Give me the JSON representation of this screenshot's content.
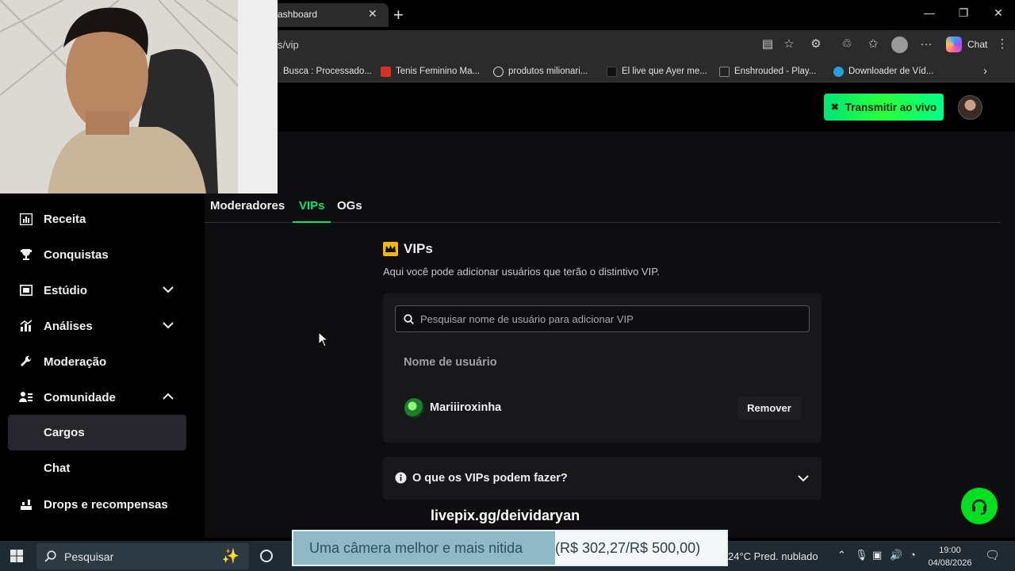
{
  "browser": {
    "tab_title": "ashboard",
    "url": "s/vip",
    "copilot_label": "Chat",
    "bookmarks": [
      {
        "label": "Busca : Processado...",
        "icon": "folder-icon"
      },
      {
        "label": "Tenis Feminino Ma...",
        "icon": "shop-icon"
      },
      {
        "label": "produtos milionari...",
        "icon": "globe-icon"
      },
      {
        "label": "El live que Ayer me...",
        "icon": "tiktok-icon"
      },
      {
        "label": "Enshrouded - Play...",
        "icon": "game-icon"
      },
      {
        "label": "Downloader de Víd...",
        "icon": "download-site-icon"
      }
    ]
  },
  "header": {
    "go_live_label": "Transmitir ao vivo"
  },
  "sidebar": {
    "items": [
      {
        "label": "Receita",
        "icon": "revenue-chart-icon"
      },
      {
        "label": "Conquistas",
        "icon": "trophy-icon"
      },
      {
        "label": "Estúdio",
        "icon": "studio-icon"
      },
      {
        "label": "Análises",
        "icon": "analytics-icon"
      },
      {
        "label": "Moderação",
        "icon": "wrench-icon"
      },
      {
        "label": "Comunidade",
        "icon": "community-icon"
      },
      {
        "label": "Drops e recompensas",
        "icon": "drops-icon"
      }
    ],
    "sub_items": [
      "Cargos",
      "Chat"
    ]
  },
  "roles_tabs": [
    "Moderadores",
    "VIPs",
    "OGs"
  ],
  "vip_section": {
    "title": "VIPs",
    "description": "Aqui você pode adicionar usuários que terão o distintivo VIP.",
    "search_placeholder": "Pesquisar nome de usuário para adicionar VIP",
    "column_header": "Nome de usuário",
    "users": [
      {
        "name": "Mariiiroxinha",
        "action": "Remover"
      }
    ],
    "faq_question": "O que os VIPs podem fazer?"
  },
  "overlay": {
    "link": "livepix.gg/deividaryan",
    "donation_goal_text": "Uma câmera melhor e mais nitida",
    "donation_goal_amount": "(R$ 302,27/R$ 500,00)"
  },
  "taskbar": {
    "search_label": "Pesquisar",
    "weather": "24°C  Pred. nublado",
    "time": "19:00",
    "date": "04/08/2026"
  },
  "colors": {
    "accent_green": "#00e676",
    "background": "#0e0e10",
    "card": "#18181b"
  }
}
